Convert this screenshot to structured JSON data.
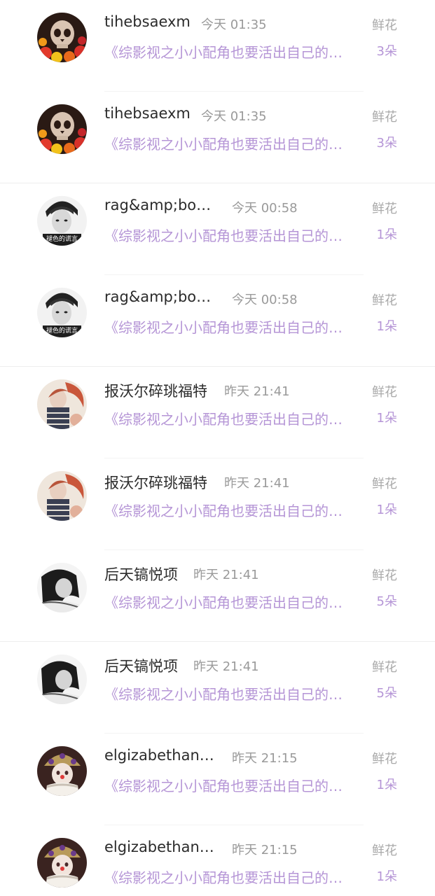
{
  "gift_rows": [
    {
      "name": "tihebsaexm",
      "time": "今天 01:35",
      "book": "《综影视之小小配角也要活出自己的…",
      "gift": "鲜花",
      "count": "3朵",
      "avatar": "skull-flower-avatar"
    },
    {
      "name": "tihebsaexm",
      "time": "今天 01:35",
      "book": "《综影视之小小配角也要活出自己的…",
      "gift": "鲜花",
      "count": "3朵",
      "avatar": "skull-flower-avatar"
    },
    {
      "name": "rag&amp;bo…",
      "time": "今天 00:58",
      "book": "《综影视之小小配角也要活出自己的…",
      "gift": "鲜花",
      "count": "1朵",
      "avatar": "bw-boy-avatar"
    },
    {
      "name": "rag&amp;bo…",
      "time": "今天 00:58",
      "book": "《综影视之小小配角也要活出自己的…",
      "gift": "鲜花",
      "count": "1朵",
      "avatar": "bw-boy-avatar"
    },
    {
      "name": "报沃尔碎珧福特",
      "time": "昨天 21:41",
      "book": "《综影视之小小配角也要活出自己的…",
      "gift": "鲜花",
      "count": "1朵",
      "avatar": "girl-pastel-avatar"
    },
    {
      "name": "报沃尔碎珧福特",
      "time": "昨天 21:41",
      "book": "《综影视之小小配角也要活出自己的…",
      "gift": "鲜花",
      "count": "1朵",
      "avatar": "girl-pastel-avatar"
    },
    {
      "name": "后天镐悦项",
      "time": "昨天 21:41",
      "book": "《综影视之小小配角也要活出自己的…",
      "gift": "鲜花",
      "count": "5朵",
      "avatar": "bw-girl-avatar"
    },
    {
      "name": "后天镐悦项",
      "time": "昨天 21:41",
      "book": "《综影视之小小配角也要活出自己的…",
      "gift": "鲜花",
      "count": "5朵",
      "avatar": "bw-girl-avatar"
    },
    {
      "name": "elgizabethan…",
      "time": "昨天 21:15",
      "book": "《综影视之小小配角也要活出自己的…",
      "gift": "鲜花",
      "count": "1朵",
      "avatar": "clown-avatar"
    },
    {
      "name": "elgizabethan…",
      "time": "昨天 21:15",
      "book": "《综影视之小小配角也要活出自己的…",
      "gift": "鲜花",
      "count": "1朵",
      "avatar": "clown-avatar"
    }
  ],
  "avatar_caption": "褪色的谎言"
}
